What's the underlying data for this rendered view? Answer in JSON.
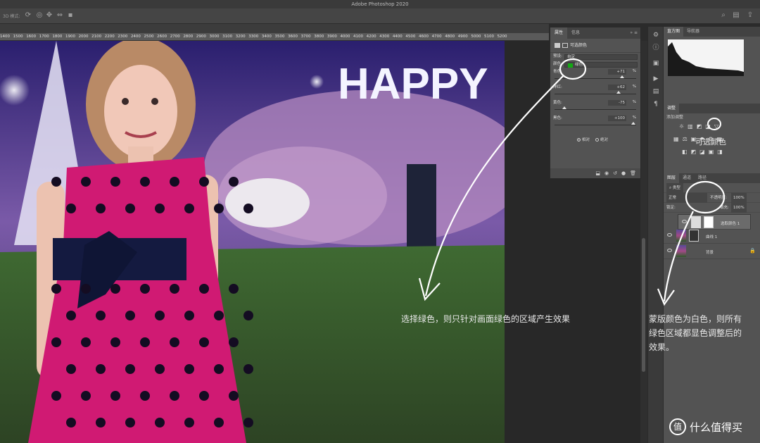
{
  "app": {
    "title": "Adobe Photoshop 2020",
    "mode_label": "3D 模式:"
  },
  "ruler": {
    "ticks": [
      "1400",
      "1500",
      "1600",
      "1700",
      "1800",
      "1900",
      "2000",
      "2100",
      "2200",
      "2300",
      "2400",
      "2500",
      "2600",
      "2700",
      "2800",
      "2900",
      "3000",
      "3100",
      "3200",
      "3300",
      "3400",
      "3500",
      "3600",
      "3700",
      "3800",
      "3900",
      "4000",
      "4100",
      "4200",
      "4300",
      "4400",
      "4500",
      "4600",
      "4700",
      "4800",
      "4900",
      "5000",
      "5100",
      "5200"
    ]
  },
  "canvas": {
    "sign_text": "HAPPY"
  },
  "properties": {
    "tabs": [
      "属性",
      "信息"
    ],
    "panel_title": "可选颜色",
    "preset_label": "预设:",
    "preset_value": "自定",
    "color_label": "颜色:",
    "color_value": "绿色",
    "swatch_color": "#12a912",
    "sliders": [
      {
        "label": "青色:",
        "value": "+71",
        "fraction": 0.855
      },
      {
        "label": "洋红:",
        "value": "+62",
        "fraction": 0.81
      },
      {
        "label": "黄色:",
        "value": "-75",
        "fraction": 0.125
      },
      {
        "label": "黑色:",
        "value": "+100",
        "fraction": 1.0
      }
    ],
    "pct": "%",
    "method_relative": "相对",
    "method_absolute": "绝对",
    "method_selected": "相对"
  },
  "histogram_panel": {
    "tabs": [
      "直方图",
      "导航器"
    ]
  },
  "adjustments": {
    "tab": "调整",
    "add_label": "添加调整",
    "row1": [
      "☼",
      "▥",
      "◩",
      "◪",
      "▽"
    ],
    "row2": [
      "▦",
      "⚖",
      "▣",
      "◓",
      "⚙",
      "▦"
    ],
    "row3": [
      "◧",
      "◩",
      "◪",
      "▣",
      "◨"
    ]
  },
  "layers": {
    "tabs": [
      "图层",
      "通道",
      "路径"
    ],
    "filter_label": "类型",
    "blend_mode": "正常",
    "opacity_label": "不透明度:",
    "opacity_value": "100%",
    "lock_label": "锁定:",
    "fill_label": "填充:",
    "fill_value": "100%",
    "items": [
      {
        "name": "选取颜色 1",
        "selected": true
      },
      {
        "name": "曲线 1",
        "selected": false
      },
      {
        "name": "背景",
        "selected": false
      }
    ]
  },
  "annotations": {
    "circle_label": "可选颜色",
    "canvas_note": "选择绿色，则只针对画面绿色的区域产生效果",
    "mask_note_lines": [
      "蒙版颜色为白色，则所有",
      "绿色区域都显色调整后的",
      "效果。"
    ]
  },
  "watermark": {
    "icon": "值",
    "text": "什么值得买"
  }
}
